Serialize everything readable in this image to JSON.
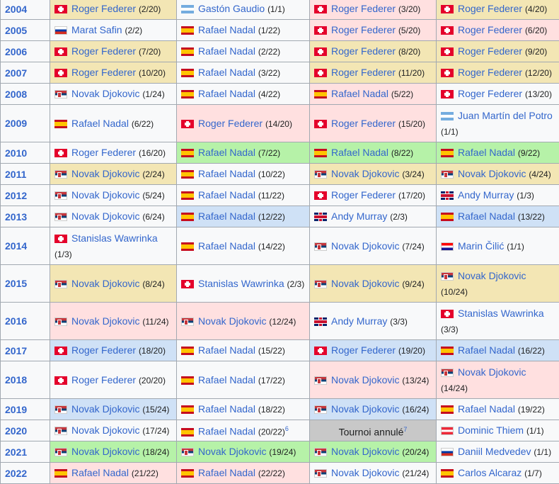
{
  "rows": [
    {
      "year": "2004",
      "size": "small",
      "cells": [
        {
          "bg": "y",
          "flag": "sui",
          "flag_icon": "switzerland-flag-icon",
          "name": "Roger Federer",
          "count": "(2/20)"
        },
        {
          "bg": "w",
          "flag": "arg",
          "flag_icon": "argentina-flag-icon",
          "name": "Gastón Gaudio",
          "count": "(1/1)"
        },
        {
          "bg": "p",
          "flag": "sui",
          "flag_icon": "switzerland-flag-icon",
          "name": "Roger Federer",
          "count": "(3/20)"
        },
        {
          "bg": "y",
          "flag": "sui",
          "flag_icon": "switzerland-flag-icon",
          "name": "Roger Federer",
          "count": "(4/20)"
        }
      ]
    },
    {
      "year": "2005",
      "size": "small",
      "cells": [
        {
          "bg": "w",
          "flag": "rus",
          "flag_icon": "russia-flag-icon",
          "name": "Marat Safin",
          "count": "(2/2)"
        },
        {
          "bg": "w",
          "flag": "esp",
          "flag_icon": "spain-flag-icon",
          "name": "Rafael Nadal",
          "count": "(1/22)"
        },
        {
          "bg": "p",
          "flag": "sui",
          "flag_icon": "switzerland-flag-icon",
          "name": "Roger Federer",
          "count": "(5/20)"
        },
        {
          "bg": "p",
          "flag": "sui",
          "flag_icon": "switzerland-flag-icon",
          "name": "Roger Federer",
          "count": "(6/20)"
        }
      ]
    },
    {
      "year": "2006",
      "size": "small",
      "cells": [
        {
          "bg": "y",
          "flag": "sui",
          "flag_icon": "switzerland-flag-icon",
          "name": "Roger Federer",
          "count": "(7/20)"
        },
        {
          "bg": "w",
          "flag": "esp",
          "flag_icon": "spain-flag-icon",
          "name": "Rafael Nadal",
          "count": "(2/22)"
        },
        {
          "bg": "y",
          "flag": "sui",
          "flag_icon": "switzerland-flag-icon",
          "name": "Roger Federer",
          "count": "(8/20)"
        },
        {
          "bg": "y",
          "flag": "sui",
          "flag_icon": "switzerland-flag-icon",
          "name": "Roger Federer",
          "count": "(9/20)"
        }
      ]
    },
    {
      "year": "2007",
      "size": "small",
      "cells": [
        {
          "bg": "y",
          "flag": "sui",
          "flag_icon": "switzerland-flag-icon",
          "name": "Roger Federer",
          "count": "(10/20)"
        },
        {
          "bg": "w",
          "flag": "esp",
          "flag_icon": "spain-flag-icon",
          "name": "Rafael Nadal",
          "count": "(3/22)"
        },
        {
          "bg": "y",
          "flag": "sui",
          "flag_icon": "switzerland-flag-icon",
          "name": "Roger Federer",
          "count": "(11/20)"
        },
        {
          "bg": "y",
          "flag": "sui",
          "flag_icon": "switzerland-flag-icon",
          "name": "Roger Federer",
          "count": "(12/20)"
        }
      ]
    },
    {
      "year": "2008",
      "size": "small",
      "cells": [
        {
          "bg": "w",
          "flag": "srb",
          "flag_icon": "serbia-flag-icon",
          "name": "Novak Djokovic",
          "count": "(1/24)"
        },
        {
          "bg": "w",
          "flag": "esp",
          "flag_icon": "spain-flag-icon",
          "name": "Rafael Nadal",
          "count": "(4/22)"
        },
        {
          "bg": "p",
          "flag": "esp",
          "flag_icon": "spain-flag-icon",
          "name": "Rafael Nadal",
          "count": "(5/22)"
        },
        {
          "bg": "w",
          "flag": "sui",
          "flag_icon": "switzerland-flag-icon",
          "name": "Roger Federer",
          "count": "(13/20)"
        }
      ]
    },
    {
      "year": "2009",
      "size": "tall",
      "cells": [
        {
          "bg": "w",
          "flag": "esp",
          "flag_icon": "spain-flag-icon",
          "name": "Rafael Nadal",
          "count": "(6/22)"
        },
        {
          "bg": "p",
          "flag": "sui",
          "flag_icon": "switzerland-flag-icon",
          "name": "Roger Federer",
          "count": "(14/20)"
        },
        {
          "bg": "p",
          "flag": "sui",
          "flag_icon": "switzerland-flag-icon",
          "name": "Roger Federer",
          "count": "(15/20)"
        },
        {
          "bg": "w",
          "flag": "arg",
          "flag_icon": "argentina-flag-icon",
          "name": "Juan Martín del Potro",
          "count": "(1/1)",
          "wrap": true
        }
      ]
    },
    {
      "year": "2010",
      "size": "small",
      "cells": [
        {
          "bg": "w",
          "flag": "sui",
          "flag_icon": "switzerland-flag-icon",
          "name": "Roger Federer",
          "count": "(16/20)"
        },
        {
          "bg": "g",
          "flag": "esp",
          "flag_icon": "spain-flag-icon",
          "name": "Rafael Nadal",
          "count": "(7/22)"
        },
        {
          "bg": "g",
          "flag": "esp",
          "flag_icon": "spain-flag-icon",
          "name": "Rafael Nadal",
          "count": "(8/22)"
        },
        {
          "bg": "g",
          "flag": "esp",
          "flag_icon": "spain-flag-icon",
          "name": "Rafael Nadal",
          "count": "(9/22)"
        }
      ]
    },
    {
      "year": "2011",
      "size": "small",
      "cells": [
        {
          "bg": "y",
          "flag": "srb",
          "flag_icon": "serbia-flag-icon",
          "name": "Novak Djokovic",
          "count": "(2/24)"
        },
        {
          "bg": "w",
          "flag": "esp",
          "flag_icon": "spain-flag-icon",
          "name": "Rafael Nadal",
          "count": "(10/22)"
        },
        {
          "bg": "y",
          "flag": "srb",
          "flag_icon": "serbia-flag-icon",
          "name": "Novak Djokovic",
          "count": "(3/24)"
        },
        {
          "bg": "y",
          "flag": "srb",
          "flag_icon": "serbia-flag-icon",
          "name": "Novak Djokovic",
          "count": "(4/24)"
        }
      ]
    },
    {
      "year": "2012",
      "size": "small",
      "cells": [
        {
          "bg": "w",
          "flag": "srb",
          "flag_icon": "serbia-flag-icon",
          "name": "Novak Djokovic",
          "count": "(5/24)"
        },
        {
          "bg": "w",
          "flag": "esp",
          "flag_icon": "spain-flag-icon",
          "name": "Rafael Nadal",
          "count": "(11/22)"
        },
        {
          "bg": "w",
          "flag": "sui",
          "flag_icon": "switzerland-flag-icon",
          "name": "Roger Federer",
          "count": "(17/20)"
        },
        {
          "bg": "w",
          "flag": "gbr",
          "flag_icon": "united-kingdom-flag-icon",
          "name": "Andy Murray",
          "count": "(1/3)"
        }
      ]
    },
    {
      "year": "2013",
      "size": "small",
      "cells": [
        {
          "bg": "w",
          "flag": "srb",
          "flag_icon": "serbia-flag-icon",
          "name": "Novak Djokovic",
          "count": "(6/24)"
        },
        {
          "bg": "b",
          "flag": "esp",
          "flag_icon": "spain-flag-icon",
          "name": "Rafael Nadal",
          "count": "(12/22)"
        },
        {
          "bg": "w",
          "flag": "gbr",
          "flag_icon": "united-kingdom-flag-icon",
          "name": "Andy Murray",
          "count": "(2/3)"
        },
        {
          "bg": "b",
          "flag": "esp",
          "flag_icon": "spain-flag-icon",
          "name": "Rafael Nadal",
          "count": "(13/22)"
        }
      ]
    },
    {
      "year": "2014",
      "size": "tall",
      "cells": [
        {
          "bg": "w",
          "flag": "sui",
          "flag_icon": "switzerland-flag-icon",
          "name": "Stanislas Wawrinka",
          "count": "(1/3)",
          "wrap": true
        },
        {
          "bg": "w",
          "flag": "esp",
          "flag_icon": "spain-flag-icon",
          "name": "Rafael Nadal",
          "count": "(14/22)"
        },
        {
          "bg": "w",
          "flag": "srb",
          "flag_icon": "serbia-flag-icon",
          "name": "Novak Djokovic",
          "count": "(7/24)"
        },
        {
          "bg": "w",
          "flag": "cro",
          "flag_icon": "croatia-flag-icon",
          "name": "Marin Čilić",
          "count": "(1/1)"
        }
      ]
    },
    {
      "year": "2015",
      "size": "tall",
      "cells": [
        {
          "bg": "y",
          "flag": "srb",
          "flag_icon": "serbia-flag-icon",
          "name": "Novak Djokovic",
          "count": "(8/24)"
        },
        {
          "bg": "w",
          "flag": "sui",
          "flag_icon": "switzerland-flag-icon",
          "name": "Stanislas Wawrinka",
          "count": "(2/3)"
        },
        {
          "bg": "y",
          "flag": "srb",
          "flag_icon": "serbia-flag-icon",
          "name": "Novak Djokovic",
          "count": "(9/24)"
        },
        {
          "bg": "y",
          "flag": "srb",
          "flag_icon": "serbia-flag-icon",
          "name": "Novak Djokovic",
          "count": "(10/24)",
          "wrap": true
        }
      ]
    },
    {
      "year": "2016",
      "size": "tall",
      "cells": [
        {
          "bg": "p",
          "flag": "srb",
          "flag_icon": "serbia-flag-icon",
          "name": "Novak Djokovic",
          "count": "(11/24)"
        },
        {
          "bg": "p",
          "flag": "srb",
          "flag_icon": "serbia-flag-icon",
          "name": "Novak Djokovic",
          "count": "(12/24)"
        },
        {
          "bg": "w",
          "flag": "gbr",
          "flag_icon": "united-kingdom-flag-icon",
          "name": "Andy Murray",
          "count": "(3/3)"
        },
        {
          "bg": "w",
          "flag": "sui",
          "flag_icon": "switzerland-flag-icon",
          "name": "Stanislas Wawrinka",
          "count": "(3/3)",
          "wrap": true
        }
      ]
    },
    {
      "year": "2017",
      "size": "small",
      "cells": [
        {
          "bg": "b",
          "flag": "sui",
          "flag_icon": "switzerland-flag-icon",
          "name": "Roger Federer",
          "count": "(18/20)"
        },
        {
          "bg": "w",
          "flag": "esp",
          "flag_icon": "spain-flag-icon",
          "name": "Rafael Nadal",
          "count": "(15/22)"
        },
        {
          "bg": "b",
          "flag": "sui",
          "flag_icon": "switzerland-flag-icon",
          "name": "Roger Federer",
          "count": "(19/20)"
        },
        {
          "bg": "b",
          "flag": "esp",
          "flag_icon": "spain-flag-icon",
          "name": "Rafael Nadal",
          "count": "(16/22)"
        }
      ]
    },
    {
      "year": "2018",
      "size": "tall",
      "cells": [
        {
          "bg": "w",
          "flag": "sui",
          "flag_icon": "switzerland-flag-icon",
          "name": "Roger Federer",
          "count": "(20/20)"
        },
        {
          "bg": "w",
          "flag": "esp",
          "flag_icon": "spain-flag-icon",
          "name": "Rafael Nadal",
          "count": "(17/22)"
        },
        {
          "bg": "p",
          "flag": "srb",
          "flag_icon": "serbia-flag-icon",
          "name": "Novak Djokovic",
          "count": "(13/24)"
        },
        {
          "bg": "p",
          "flag": "srb",
          "flag_icon": "serbia-flag-icon",
          "name": "Novak Djokovic",
          "count": "(14/24)",
          "wrap": true
        }
      ]
    },
    {
      "year": "2019",
      "size": "small",
      "cells": [
        {
          "bg": "b",
          "flag": "srb",
          "flag_icon": "serbia-flag-icon",
          "name": "Novak Djokovic",
          "count": "(15/24)"
        },
        {
          "bg": "w",
          "flag": "esp",
          "flag_icon": "spain-flag-icon",
          "name": "Rafael Nadal",
          "count": "(18/22)"
        },
        {
          "bg": "b",
          "flag": "srb",
          "flag_icon": "serbia-flag-icon",
          "name": "Novak Djokovic",
          "count": "(16/24)"
        },
        {
          "bg": "w",
          "flag": "esp",
          "flag_icon": "spain-flag-icon",
          "name": "Rafael Nadal",
          "count": "(19/22)"
        }
      ]
    },
    {
      "year": "2020",
      "size": "small",
      "cells": [
        {
          "bg": "w",
          "flag": "srb",
          "flag_icon": "serbia-flag-icon",
          "name": "Novak Djokovic",
          "count": "(17/24)"
        },
        {
          "bg": "w",
          "flag": "esp",
          "flag_icon": "spain-flag-icon",
          "name": "Rafael Nadal",
          "count": "(20/22)",
          "note": "6"
        },
        {
          "bg": "grey",
          "cancelled": true,
          "text": "Tournoi annulé",
          "note": "7"
        },
        {
          "bg": "w",
          "flag": "aut",
          "flag_icon": "austria-flag-icon",
          "name": "Dominic Thiem",
          "count": "(1/1)"
        }
      ]
    },
    {
      "year": "2021",
      "size": "small",
      "cells": [
        {
          "bg": "g",
          "flag": "srb",
          "flag_icon": "serbia-flag-icon",
          "name": "Novak Djokovic",
          "count": "(18/24)"
        },
        {
          "bg": "g",
          "flag": "srb",
          "flag_icon": "serbia-flag-icon",
          "name": "Novak Djokovic",
          "count": "(19/24)"
        },
        {
          "bg": "g",
          "flag": "srb",
          "flag_icon": "serbia-flag-icon",
          "name": "Novak Djokovic",
          "count": "(20/24)"
        },
        {
          "bg": "w",
          "flag": "rus",
          "flag_icon": "russia-flag-icon",
          "name": "Daniil Medvedev",
          "count": "(1/1)"
        }
      ]
    },
    {
      "year": "2022",
      "size": "small",
      "cells": [
        {
          "bg": "p",
          "flag": "esp",
          "flag_icon": "spain-flag-icon",
          "name": "Rafael Nadal",
          "count": "(21/22)"
        },
        {
          "bg": "p",
          "flag": "esp",
          "flag_icon": "spain-flag-icon",
          "name": "Rafael Nadal",
          "count": "(22/22)"
        },
        {
          "bg": "w",
          "flag": "srb",
          "flag_icon": "serbia-flag-icon",
          "name": "Novak Djokovic",
          "count": "(21/24)"
        },
        {
          "bg": "w",
          "flag": "esp",
          "flag_icon": "spain-flag-icon",
          "name": "Carlos Alcaraz",
          "count": "(1/7)"
        }
      ]
    }
  ]
}
